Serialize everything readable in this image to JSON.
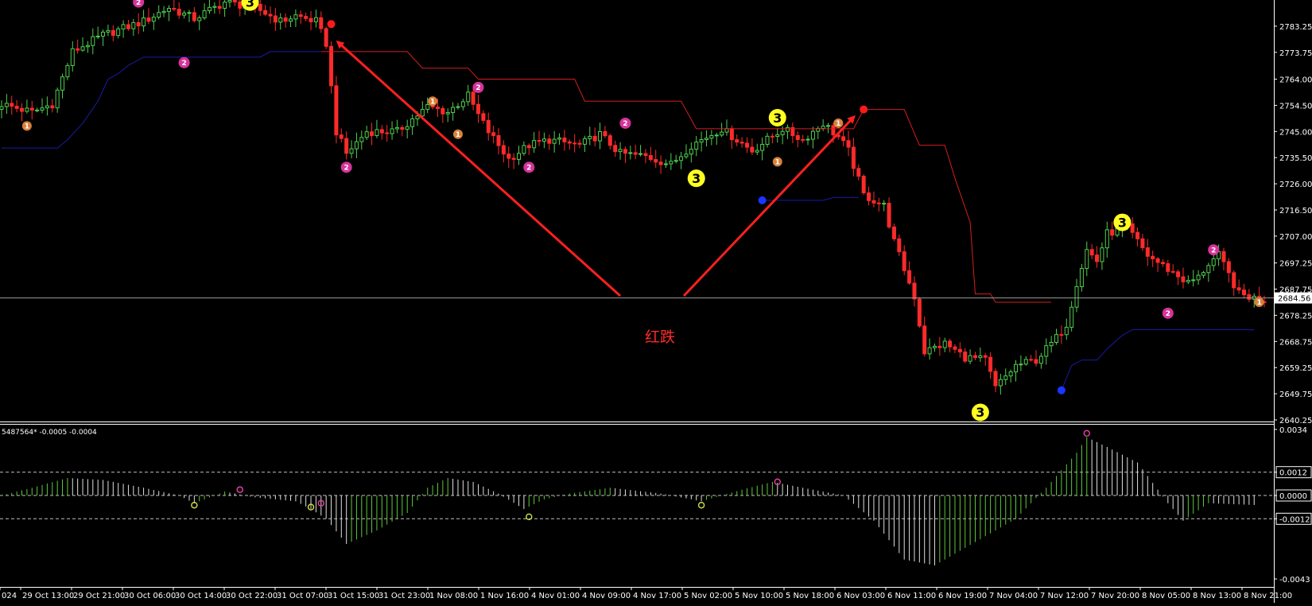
{
  "chart_data": [
    {
      "type": "candlestick",
      "title": "",
      "price_axis": {
        "min": 2640.25,
        "max": 2792.75,
        "ticks": [
          "2640.25",
          "2649.75",
          "2659.25",
          "2668.75",
          "2678.25",
          "2687.75",
          "2697.25",
          "2707.00",
          "2716.50",
          "2726.00",
          "2735.50",
          "2745.00",
          "2754.50",
          "2764.00",
          "2773.75",
          "2783.25"
        ],
        "current_price": "2684.56"
      },
      "time_labels": [
        "024",
        "29 Oct 13:00",
        "29 Oct 21:00",
        "30 Oct 06:00",
        "30 Oct 14:00",
        "30 Oct 22:00",
        "31 Oct 07:00",
        "31 Oct 15:00",
        "31 Oct 23:00",
        "1 Nov 08:00",
        "1 Nov 16:00",
        "4 Nov 01:00",
        "4 Nov 09:00",
        "4 Nov 17:00",
        "5 Nov 02:00",
        "5 Nov 10:00",
        "5 Nov 18:00",
        "6 Nov 03:00",
        "6 Nov 11:00",
        "6 Nov 19:00",
        "7 Nov 04:00",
        "7 Nov 12:00",
        "7 Nov 20:00",
        "8 Nov 05:00",
        "8 Nov 13:00",
        "8 Nov 21:00"
      ],
      "bar_count": 250,
      "close_path": [
        [
          0,
          2755
        ],
        [
          6,
          2752
        ],
        [
          10,
          2755
        ],
        [
          14,
          2774
        ],
        [
          20,
          2780
        ],
        [
          28,
          2785
        ],
        [
          33,
          2790
        ],
        [
          38,
          2786
        ],
        [
          44,
          2792
        ],
        [
          50,
          2790
        ],
        [
          55,
          2785
        ],
        [
          58,
          2787
        ],
        [
          62,
          2785
        ],
        [
          64,
          2777
        ],
        [
          66,
          2745
        ],
        [
          68,
          2737
        ],
        [
          72,
          2745
        ],
        [
          78,
          2745
        ],
        [
          84,
          2754
        ],
        [
          88,
          2752
        ],
        [
          92,
          2758
        ],
        [
          94,
          2751
        ],
        [
          96,
          2745
        ],
        [
          100,
          2735
        ],
        [
          104,
          2740
        ],
        [
          108,
          2742
        ],
        [
          114,
          2740
        ],
        [
          118,
          2744
        ],
        [
          122,
          2737
        ],
        [
          127,
          2736
        ],
        [
          132,
          2733
        ],
        [
          136,
          2740
        ],
        [
          142,
          2746
        ],
        [
          148,
          2738
        ],
        [
          154,
          2746
        ],
        [
          158,
          2742
        ],
        [
          162,
          2748
        ],
        [
          165,
          2743
        ],
        [
          167,
          2738
        ],
        [
          170,
          2722
        ],
        [
          174,
          2718
        ],
        [
          176,
          2705
        ],
        [
          180,
          2685
        ],
        [
          182,
          2665
        ],
        [
          186,
          2668
        ],
        [
          190,
          2663
        ],
        [
          194,
          2662
        ],
        [
          196,
          2652
        ],
        [
          200,
          2660
        ],
        [
          204,
          2662
        ],
        [
          208,
          2670
        ],
        [
          210,
          2675
        ],
        [
          212,
          2690
        ],
        [
          214,
          2702
        ],
        [
          216,
          2698
        ],
        [
          218,
          2708
        ],
        [
          222,
          2710
        ],
        [
          226,
          2700
        ],
        [
          230,
          2695
        ],
        [
          234,
          2690
        ],
        [
          236,
          2692
        ],
        [
          238,
          2697
        ],
        [
          240,
          2700
        ],
        [
          244,
          2686
        ],
        [
          248,
          2684
        ]
      ],
      "markers": [
        {
          "label": "3",
          "bar": 49,
          "price": 2792,
          "kind": "yellow-3"
        },
        {
          "label": "3",
          "bar": 137,
          "price": 2728,
          "kind": "yellow-3"
        },
        {
          "label": "3",
          "bar": 153,
          "price": 2750,
          "kind": "yellow-3"
        },
        {
          "label": "3",
          "bar": 193,
          "price": 2643,
          "kind": "yellow-3"
        },
        {
          "label": "3",
          "bar": 221,
          "price": 2712,
          "kind": "yellow-3"
        },
        {
          "label": "2",
          "bar": 27,
          "price": 2792,
          "kind": "magenta"
        },
        {
          "label": "2",
          "bar": 36,
          "price": 2770,
          "kind": "magenta"
        },
        {
          "label": "2",
          "bar": 68,
          "price": 2732,
          "kind": "magenta"
        },
        {
          "label": "2",
          "bar": 94,
          "price": 2761,
          "kind": "magenta"
        },
        {
          "label": "2",
          "bar": 104,
          "price": 2732,
          "kind": "magenta"
        },
        {
          "label": "2",
          "bar": 123,
          "price": 2748,
          "kind": "magenta"
        },
        {
          "label": "2",
          "bar": 230,
          "price": 2679,
          "kind": "magenta"
        },
        {
          "label": "2",
          "bar": 239,
          "price": 2702,
          "kind": "magenta"
        },
        {
          "label": "1",
          "bar": 5,
          "price": 2747,
          "kind": "orange"
        },
        {
          "label": "1",
          "bar": 85,
          "price": 2756,
          "kind": "orange"
        },
        {
          "label": "1",
          "bar": 90,
          "price": 2744,
          "kind": "orange"
        },
        {
          "label": "1",
          "bar": 153,
          "price": 2734,
          "kind": "orange"
        },
        {
          "label": "1",
          "bar": 165,
          "price": 2748,
          "kind": "orange"
        },
        {
          "label": "1",
          "bar": 248,
          "price": 2683,
          "kind": "orange"
        }
      ],
      "stops": {
        "upper": [
          [
            63,
            2774
          ],
          [
            64,
            2774
          ],
          [
            80,
            2774
          ],
          [
            83,
            2768
          ],
          [
            92,
            2768
          ],
          [
            94,
            2764
          ],
          [
            113,
            2764
          ],
          [
            115,
            2756
          ],
          [
            134,
            2756
          ],
          [
            137,
            2746
          ],
          [
            168,
            2746
          ],
          [
            170,
            2753
          ],
          [
            178,
            2753
          ],
          [
            181,
            2740
          ],
          [
            186,
            2740
          ],
          [
            188,
            2728
          ],
          [
            191,
            2712
          ],
          [
            192,
            2686
          ],
          [
            195,
            2686
          ],
          [
            196,
            2683
          ],
          [
            207,
            2683
          ]
        ],
        "lower": [
          [
            0,
            2739
          ],
          [
            11,
            2739
          ],
          [
            13,
            2742
          ],
          [
            16,
            2748
          ],
          [
            19,
            2756
          ],
          [
            21,
            2764
          ],
          [
            23,
            2766
          ],
          [
            25,
            2769
          ],
          [
            28,
            2772
          ],
          [
            51,
            2772
          ],
          [
            53,
            2774
          ],
          [
            63,
            2774
          ],
          [
            150,
            2720
          ],
          [
            162,
            2720
          ],
          [
            164,
            2721
          ],
          [
            169,
            2721
          ],
          [
            209,
            2651
          ],
          [
            211,
            2660
          ],
          [
            213,
            2662
          ],
          [
            216,
            2662
          ],
          [
            218,
            2666
          ],
          [
            221,
            2671
          ],
          [
            223,
            2673
          ],
          [
            247,
            2673
          ]
        ]
      },
      "dots": [
        {
          "bar": 65,
          "price": 2784,
          "color": "red"
        },
        {
          "bar": 170,
          "price": 2753,
          "color": "red"
        },
        {
          "bar": 150,
          "price": 2720,
          "color": "blue"
        },
        {
          "bar": 209,
          "price": 2651,
          "color": "blue"
        }
      ],
      "annotation": {
        "text": "红跌",
        "color": "#ff2a2a"
      }
    },
    {
      "type": "bar",
      "title": "5487564* -0.0005 -0.0004",
      "ylim": [
        -0.0043,
        0.0034
      ],
      "ticks": [
        "0.0034",
        "0.0012",
        "0.0000",
        "-0.0012",
        "-0.0043"
      ],
      "levels": [
        0.0012,
        -0.0012
      ],
      "histogram_path": [
        [
          0,
          0
        ],
        [
          6,
          0.0004
        ],
        [
          13,
          0.0009
        ],
        [
          20,
          0.0008
        ],
        [
          28,
          0.0004
        ],
        [
          35,
          0
        ],
        [
          38,
          -0.0004
        ],
        [
          44,
          0.0002
        ],
        [
          50,
          -0.0001
        ],
        [
          58,
          -0.0003
        ],
        [
          61,
          -0.0007
        ],
        [
          64,
          -0.0012
        ],
        [
          68,
          -0.0025
        ],
        [
          74,
          -0.0018
        ],
        [
          80,
          -0.0009
        ],
        [
          84,
          0.0004
        ],
        [
          88,
          0.0009
        ],
        [
          93,
          0.0007
        ],
        [
          98,
          0.0001
        ],
        [
          103,
          -0.0007
        ],
        [
          107,
          -0.0002
        ],
        [
          112,
          0.0001
        ],
        [
          120,
          0.0004
        ],
        [
          130,
          0.0001
        ],
        [
          138,
          -0.0003
        ],
        [
          146,
          0.0003
        ],
        [
          152,
          0.0007
        ],
        [
          158,
          0.0004
        ],
        [
          166,
          0
        ],
        [
          172,
          -0.0013
        ],
        [
          178,
          -0.0033
        ],
        [
          184,
          -0.0036
        ],
        [
          192,
          -0.0024
        ],
        [
          200,
          -0.0012
        ],
        [
          206,
          0.0004
        ],
        [
          212,
          0.0022
        ],
        [
          214,
          0.003
        ],
        [
          218,
          0.0025
        ],
        [
          224,
          0.0017
        ],
        [
          230,
          -0.0004
        ],
        [
          233,
          -0.0013
        ],
        [
          238,
          -0.0004
        ],
        [
          248,
          -0.0005
        ]
      ],
      "markers": [
        {
          "bar": 38,
          "value": -0.0005,
          "color": "#c8d840"
        },
        {
          "bar": 47,
          "value": 0.0003,
          "color": "#e040a0"
        },
        {
          "bar": 61,
          "value": -0.0006,
          "color": "#c8d840"
        },
        {
          "bar": 63,
          "value": -0.0004,
          "color": "#e040a0"
        },
        {
          "bar": 104,
          "value": -0.0011,
          "color": "#c8d840"
        },
        {
          "bar": 138,
          "value": -0.0005,
          "color": "#c8d840"
        },
        {
          "bar": 153,
          "value": 0.0007,
          "color": "#e040a0"
        },
        {
          "bar": 214,
          "value": 0.0032,
          "color": "#e040a0"
        }
      ]
    }
  ]
}
